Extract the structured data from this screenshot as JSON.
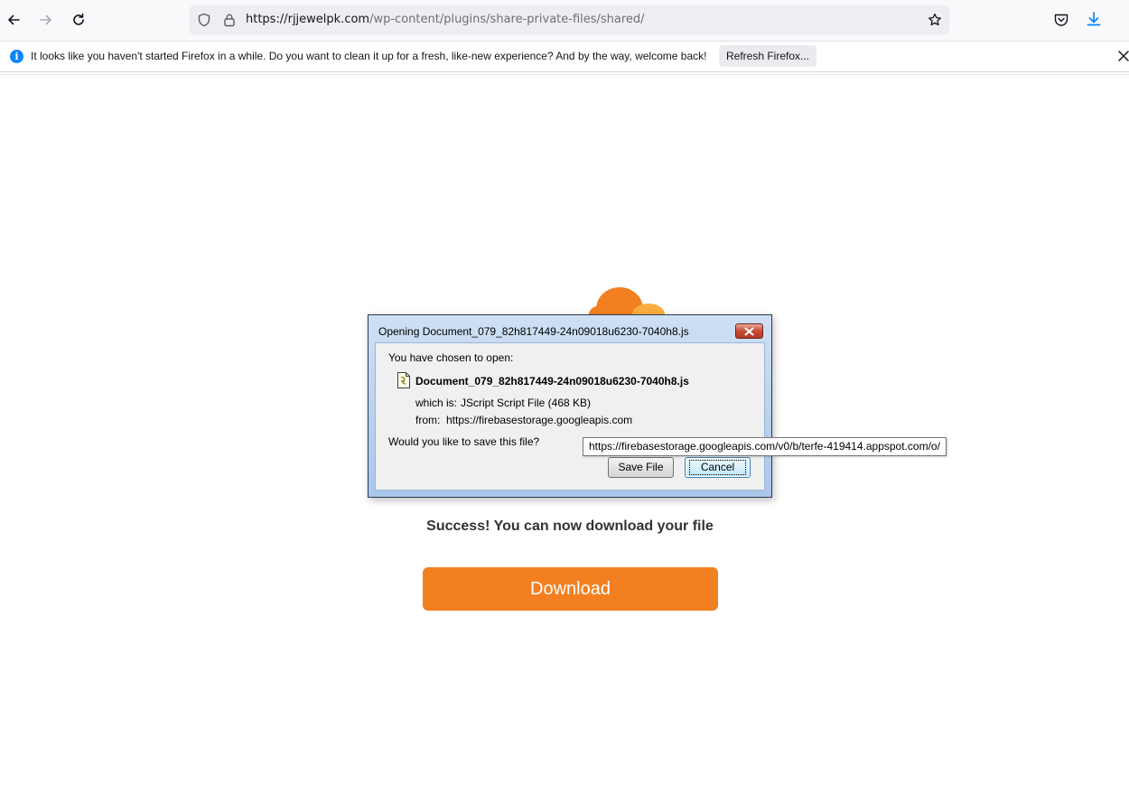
{
  "browser": {
    "url_host": "https://rjjewelpk.com",
    "url_path": "/wp-content/plugins/share-private-files/shared/",
    "icons": {
      "back": "back-arrow-icon",
      "forward": "forward-arrow-icon",
      "reload": "reload-icon",
      "tracking": "shield-icon",
      "lock": "lock-icon",
      "bookmark": "star-icon",
      "pocket": "pocket-icon",
      "downloads": "download-icon"
    }
  },
  "notification": {
    "message": "It looks like you haven't started Firefox in a while. Do you want to clean it up for a fresh, like-new experience? And by the way, welcome back!",
    "button_label": "Refresh Firefox...",
    "icon": "info-icon"
  },
  "page": {
    "success_text": "Success! You can now download your file",
    "download_label": "Download",
    "accent_color": "#f38020"
  },
  "dialog": {
    "title": "Opening Document_079_82h817449-24n09018u6230-7040h8.js",
    "chosen_label": "You have chosen to open:",
    "file_name": "Document_079_82h817449-24n09018u6230-7040h8.js",
    "which_is_label": "which is:",
    "which_is_value": "JScript Script File (468 KB)",
    "from_label": "from:",
    "from_value": "https://firebasestorage.googleapis.com",
    "question": "Would you like to save this file?",
    "save_label": "Save File",
    "cancel_label": "Cancel"
  },
  "tooltip": {
    "text": "https://firebasestorage.googleapis.com/v0/b/terfe-419414.appspot.com/o/"
  }
}
